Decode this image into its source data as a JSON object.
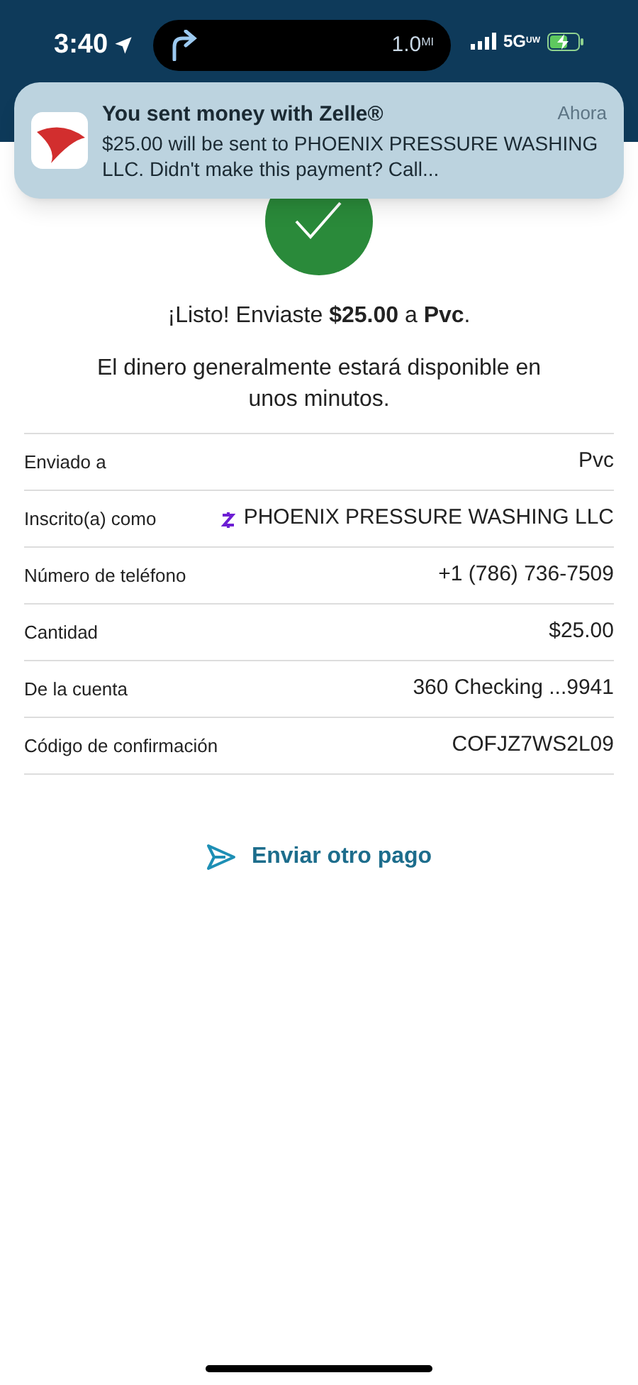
{
  "status_bar": {
    "time": "3:40",
    "distance": "1.0",
    "distance_unit": "MI",
    "network": "5G",
    "network_sub": "UW",
    "battery_charging": true
  },
  "notification": {
    "title": "You sent money with Zelle®",
    "time": "Ahora",
    "body": "$25.00 will be sent to PHOENIX PRESSURE WASHING LLC. Didn't make this payment? Call..."
  },
  "confirmation": {
    "headline": "¡Listo! Enviaste **$25.00** a **Pvc**.",
    "message": "El dinero generalmente estará disponible en unos minutos."
  },
  "details": [
    {
      "kind": "plain",
      "label": "Enviado a",
      "value": "Pvc"
    },
    {
      "kind": "zelle",
      "label": "Inscrito(a) como",
      "value": "PHOENIX PRESSURE WASHING LLC"
    },
    {
      "kind": "plain",
      "label": "Número de teléfono",
      "value": "+1 (786) 736-7509"
    },
    {
      "kind": "plain",
      "label": "Cantidad",
      "value": "$25.00"
    },
    {
      "kind": "plain",
      "label": "De la cuenta",
      "value": "360 Checking ...9941"
    },
    {
      "kind": "plain",
      "label": "Código de confirmación",
      "value": "COFJZ7WS2L09"
    }
  ],
  "action": {
    "label": "Enviar otro pago"
  }
}
